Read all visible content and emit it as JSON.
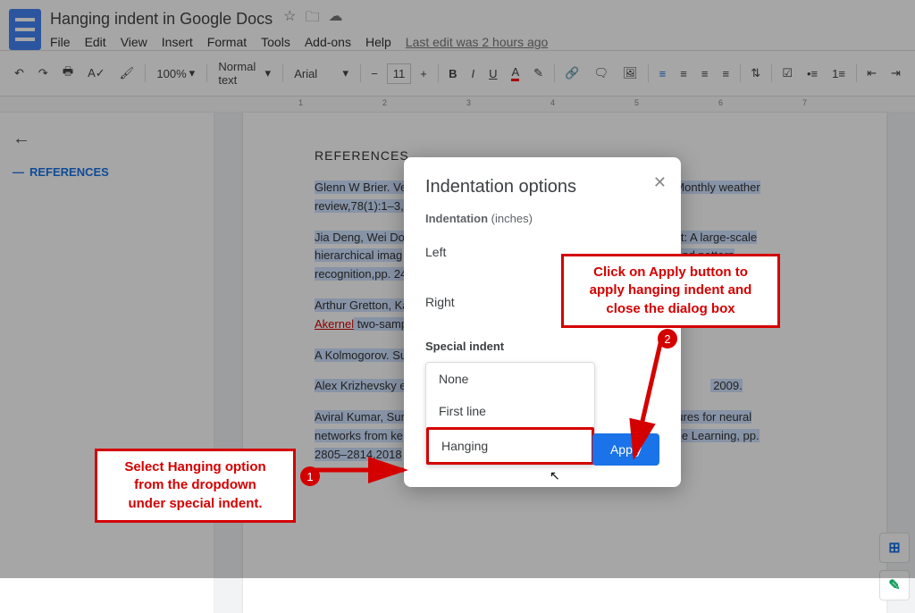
{
  "doc": {
    "title": "Hanging indent in Google Docs",
    "menus": [
      "File",
      "Edit",
      "View",
      "Insert",
      "Format",
      "Tools",
      "Add-ons",
      "Help"
    ],
    "edit_info": "Last edit was 2 hours ago"
  },
  "toolbar": {
    "zoom": "100%",
    "style": "Normal text",
    "font": "Arial",
    "size": "11"
  },
  "outline": {
    "heading": "REFERENCES"
  },
  "refs": {
    "title": "REFERENCES",
    "r1a": "Glenn W Brier. Ve",
    "r1b": "Monthly weather",
    "r1c": "review,78(1):1–3,",
    "r2a": "Jia Deng, Wei Do",
    "r2b": "genet: A large-scale",
    "r2c": "hierarchical imag",
    "r2d": "n and pattern",
    "r2e": "recognition,pp. 24",
    "r3a": "Arthur Gretton, Ka",
    "r3b": "Akernel",
    "r3c": " two-samp",
    "r4a": "A Kolmogorov. Su",
    "r5a": "Alex Krizhevsky e",
    "r5b": " 2009.",
    "r6a": "Aviral Kumar, Sun",
    "r6b": "sures for neural",
    "r6c": "networks from ke",
    "r6d": "Machine Learning, pp.",
    "r6e": "2805–2814,2018"
  },
  "dialog": {
    "title": "Indentation options",
    "subtitle_a": "Indentation",
    "subtitle_b": " (inches)",
    "left": "Left",
    "right": "Right",
    "special": "Special indent",
    "opt_none": "None",
    "opt_first": "First line",
    "opt_hanging": "Hanging",
    "apply": "Apply"
  },
  "callouts": {
    "c1": "Select Hanging option\nfrom the dropdown\nunder special indent.",
    "c2": "Click on Apply button  to\napply hanging indent and\nclose the dialog box",
    "b1": "1",
    "b2": "2"
  },
  "ruler": [
    "1",
    "2",
    "3",
    "4",
    "5",
    "6",
    "7"
  ]
}
